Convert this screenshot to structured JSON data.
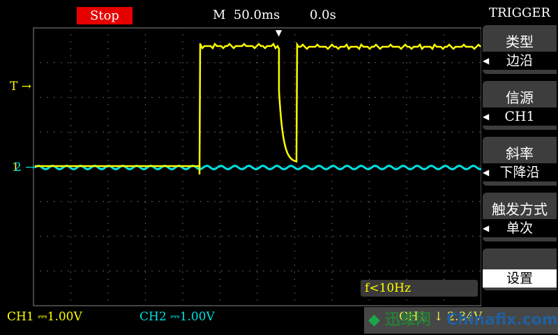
{
  "header": {
    "run_status": "Stop",
    "timebase": "M  50.0ms",
    "trigger_position": "0.0s"
  },
  "markers": {
    "trigger_level": "T",
    "ch1": "1",
    "ch2": "2",
    "arrow": "→"
  },
  "frequency": "f<10Hz",
  "bottom": {
    "ch1_label": "CH1",
    "ch1_scale": "1.00V",
    "ch2_label": "CH2",
    "ch2_scale": "1.00V",
    "trigger_source": "CH1",
    "trigger_level": "2.34V"
  },
  "watermark": {
    "logo": "◆",
    "cn": "迅维网",
    "url": "Chinafix.com"
  },
  "menu": {
    "title": "TRIGGER",
    "items": [
      {
        "label": "类型",
        "value": "边沿"
      },
      {
        "label": "信源",
        "value": "CH1"
      },
      {
        "label": "斜率",
        "value": "下降沿"
      },
      {
        "label": "触发方式",
        "value": "单次"
      }
    ],
    "setup": "设置"
  },
  "colors": {
    "ch1": "#ffff00",
    "ch2": "#00e0e0",
    "stop": "#e60000"
  },
  "icons": {
    "menu_value_arrow": "triangle-left-icon",
    "trigger_position_marker": "down-arrow-icon"
  }
}
